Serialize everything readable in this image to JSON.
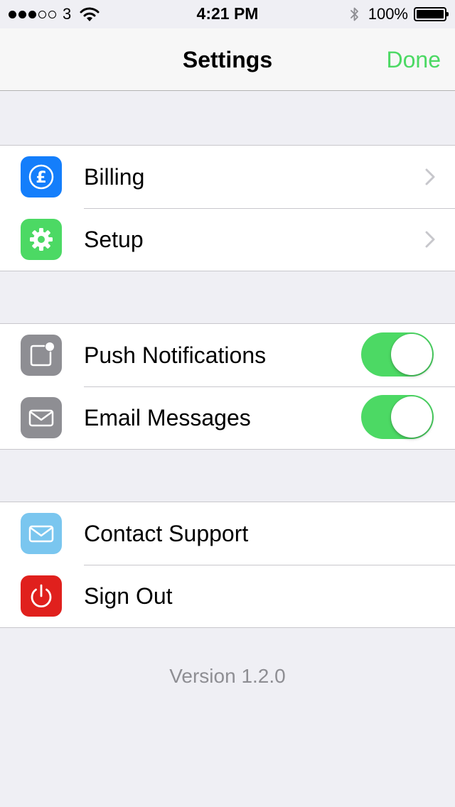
{
  "status_bar": {
    "carrier": "3",
    "time": "4:21 PM",
    "battery_percent": "100%",
    "signal_bars_filled": 3,
    "signal_bars_total": 5
  },
  "nav": {
    "title": "Settings",
    "done_label": "Done"
  },
  "colors": {
    "accent": "#4cd964",
    "billing_icon": "#147efb",
    "setup_icon": "#4cd964",
    "gray_icon": "#8e8e93",
    "support_icon": "#7ac6ef",
    "signout_icon": "#e0201d"
  },
  "groups": [
    {
      "items": [
        {
          "label": "Billing",
          "icon": "pound-currency-icon",
          "accessory": "chevron"
        },
        {
          "label": "Setup",
          "icon": "gear-icon",
          "accessory": "chevron"
        }
      ]
    },
    {
      "items": [
        {
          "label": "Push Notifications",
          "icon": "notification-badge-icon",
          "accessory": "toggle",
          "on": true
        },
        {
          "label": "Email Messages",
          "icon": "envelope-icon",
          "accessory": "toggle",
          "on": true
        }
      ]
    },
    {
      "items": [
        {
          "label": "Contact Support",
          "icon": "envelope-icon",
          "accessory": "none"
        },
        {
          "label": "Sign Out",
          "icon": "power-icon",
          "accessory": "none"
        }
      ]
    }
  ],
  "footer": {
    "version": "Version 1.2.0"
  }
}
